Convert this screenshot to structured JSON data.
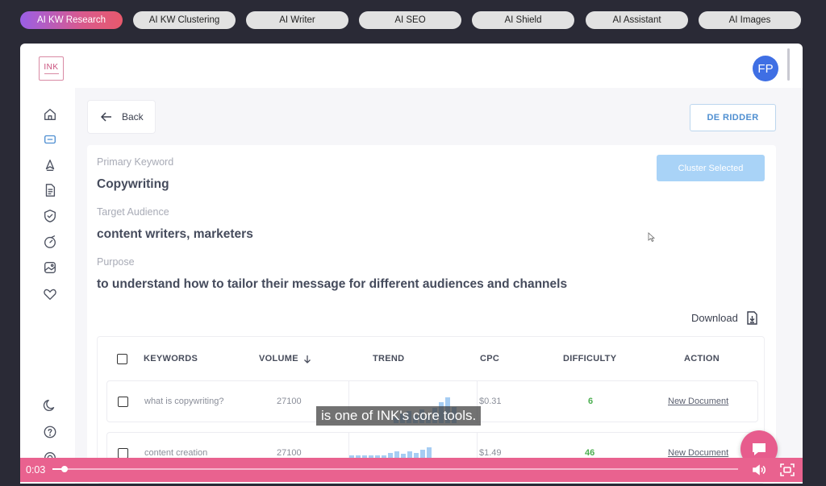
{
  "top_tabs": [
    "AI KW Research",
    "AI KW Clustering",
    "AI Writer",
    "AI SEO",
    "AI Shield",
    "AI Assistant",
    "AI Images"
  ],
  "active_tab_index": 0,
  "logo_text": "INK",
  "avatar_initials": "FP",
  "back_label": "Back",
  "org_label": "DE RIDDER",
  "cluster_label": "Cluster Selected",
  "primary_keyword_label": "Primary Keyword",
  "primary_keyword": "Copywriting",
  "audience_label": "Target Audience",
  "audience": "content writers, marketers",
  "purpose_label": "Purpose",
  "purpose": "to understand how to tailor their message for different audiences and channels",
  "download_label": "Download",
  "table": {
    "headers": [
      "KEYWORDS",
      "VOLUME",
      "TREND",
      "CPC",
      "DIFFICULTY",
      "ACTION"
    ],
    "sort_column": "VOLUME",
    "rows": [
      {
        "keyword": "what is copywriting?",
        "volume": "27100",
        "cpc": "$0.31",
        "difficulty": "6",
        "action": "New Document",
        "trend": [
          0.2,
          0.35,
          0.45,
          0.3,
          0.5,
          0.3,
          0.55,
          0.75,
          0.95,
          0.6
        ]
      },
      {
        "keyword": "content creation",
        "volume": "27100",
        "cpc": "$1.49",
        "difficulty": "46",
        "action": "New Document",
        "trend": [
          0.7,
          0.7,
          0.7,
          0.7,
          0.7,
          0.7,
          0.8,
          0.85,
          0.75,
          0.85,
          0.8,
          0.9,
          1.0
        ]
      }
    ]
  },
  "caption": "is one of INK's core tools.",
  "player": {
    "time": "0:03",
    "progress": 0.018
  },
  "colors": {
    "accent": "#e9628f",
    "brand_blue": "#4f8fd1",
    "positive": "#4caf50"
  },
  "icons": {
    "sidebar": [
      "home-icon",
      "keyword-icon",
      "writer-icon",
      "document-icon",
      "shield-icon",
      "assistant-icon",
      "image-icon",
      "heart-icon",
      "moon-icon",
      "help-icon",
      "settings-icon"
    ],
    "back": "arrow-left-icon",
    "download": "download-icon",
    "chat": "chat-icon",
    "volume": "volume-icon",
    "fullscreen": "fullscreen-icon"
  }
}
